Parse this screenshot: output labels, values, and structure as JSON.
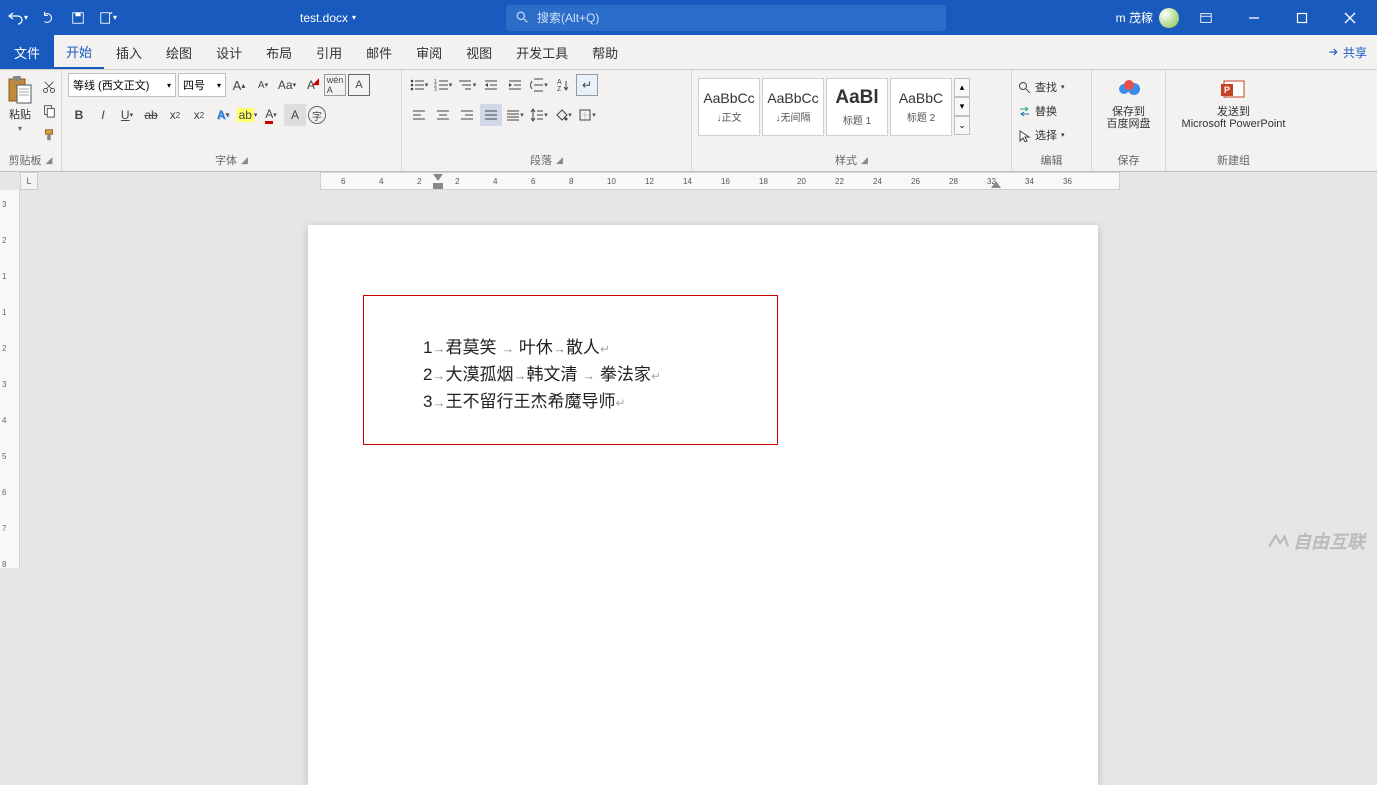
{
  "titlebar": {
    "doc_name": "test.docx",
    "search_placeholder": "搜索(Alt+Q)",
    "user_name": "m 茂稼"
  },
  "tabs": {
    "file": "文件",
    "items": [
      "开始",
      "插入",
      "绘图",
      "设计",
      "布局",
      "引用",
      "邮件",
      "审阅",
      "视图",
      "开发工具",
      "帮助"
    ],
    "active_index": 0,
    "share": "共享"
  },
  "ribbon": {
    "clipboard": {
      "label": "剪贴板",
      "paste": "粘贴"
    },
    "font": {
      "label": "字体",
      "family": "等线 (西文正文)",
      "size": "四号"
    },
    "paragraph": {
      "label": "段落"
    },
    "styles": {
      "label": "样式",
      "items": [
        {
          "preview": "AaBbCc",
          "name": "↓正文"
        },
        {
          "preview": "AaBbCc",
          "name": "↓无间隔"
        },
        {
          "preview": "AaBl",
          "name": "标题 1",
          "big": true
        },
        {
          "preview": "AaBbC",
          "name": "标题 2"
        }
      ]
    },
    "editing": {
      "label": "编辑",
      "find": "查找",
      "replace": "替换",
      "select": "选择"
    },
    "save_group": {
      "label": "保存",
      "baidu": "保存到\n百度网盘"
    },
    "new_group": {
      "label": "新建组",
      "ppt": "发送到\nMicrosoft PowerPoint"
    }
  },
  "ruler": {
    "h_marks": [
      -6,
      -4,
      -2,
      2,
      4,
      6,
      8,
      10,
      12,
      14,
      16,
      18,
      20,
      22,
      24,
      26,
      28,
      32,
      34,
      36
    ],
    "v_marks": [
      3,
      2,
      1,
      1,
      2,
      3,
      4,
      5,
      6,
      7,
      8
    ]
  },
  "document": {
    "lines": [
      {
        "n": "1",
        "cells": [
          "君莫笑 ",
          " 叶休",
          "散人"
        ]
      },
      {
        "n": "2",
        "cells": [
          "大漠孤烟",
          "韩文清 ",
          " 拳法家"
        ]
      },
      {
        "n": "3",
        "cells": [
          "王不留行王杰希魔导师"
        ]
      }
    ]
  },
  "watermark": "自由互联"
}
